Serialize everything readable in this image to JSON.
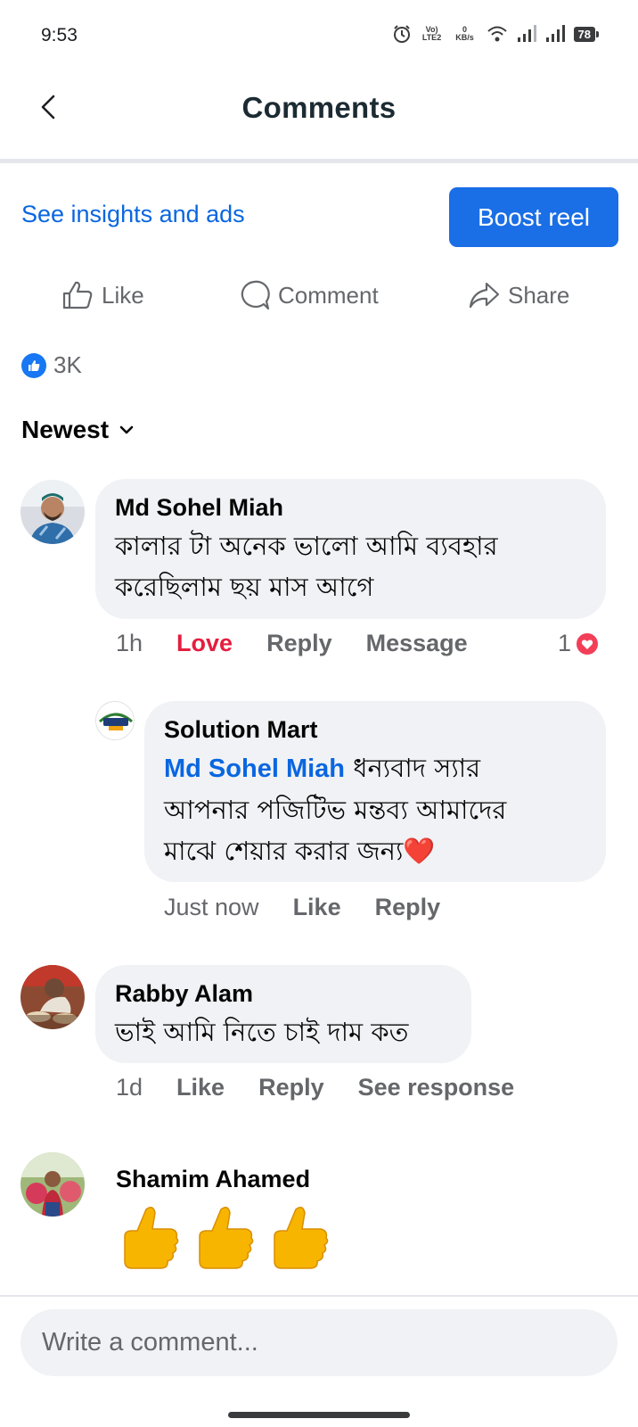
{
  "status_bar": {
    "time": "9:53",
    "network_label": "Vo) LTE2",
    "speed_value": "0",
    "speed_unit": "KB/s",
    "battery": "78"
  },
  "header": {
    "title": "Comments"
  },
  "insights": {
    "link_label": "See insights and ads",
    "boost_label": "Boost reel"
  },
  "actions": {
    "like": "Like",
    "comment": "Comment",
    "share": "Share"
  },
  "reactions": {
    "count": "3K"
  },
  "sort": {
    "label": "Newest"
  },
  "comments": [
    {
      "author": "Md Sohel Miah",
      "text_line1": "কালার টা অনেক ভালো আমি ব্যবহার",
      "text_line2": "করেছিলাম ছয় মাস আগে",
      "time": "1h",
      "reaction_label": "Love",
      "reply": "Reply",
      "message": "Message",
      "reaction_count": "1",
      "reply_item": {
        "author": "Solution Mart",
        "mention": "Md Sohel Miah",
        "text_line1": " ধন্যবাদ স্যার",
        "text_line2": "আপনার পজিটিভ মন্তব্য আমাদের",
        "text_line3": "মাঝে শেয়ার করার জন্য❤️",
        "time": "Just now",
        "like": "Like",
        "reply": "Reply"
      }
    },
    {
      "author": "Rabby Alam",
      "text": "ভাই আমি নিতে চাই দাম কত",
      "time": "1d",
      "like": "Like",
      "reply": "Reply",
      "see_response": "See response"
    },
    {
      "author": "Shamim Ahamed",
      "text": "👍👍👍"
    }
  ],
  "composer": {
    "placeholder": "Write a comment..."
  },
  "colors": {
    "accent": "#1a6ee6",
    "link": "#0a66e0",
    "love": "#e41e3f",
    "bubble": "#f0f2f5",
    "muted": "#65676b"
  }
}
